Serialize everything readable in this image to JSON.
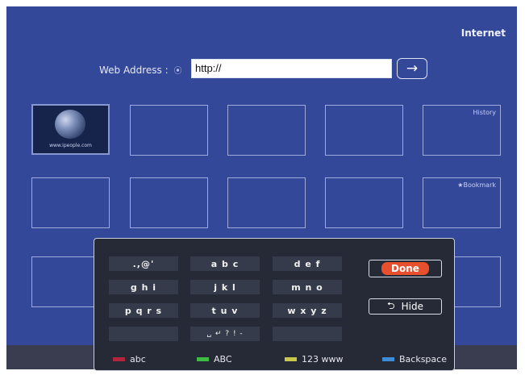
{
  "app_title": "Internet",
  "address_bar": {
    "label": "Web Address :",
    "label_icon": "circle-info-icon",
    "value": "http://",
    "go_icon": "arrow-right-icon",
    "go_glyph": "→"
  },
  "tiles": {
    "thumbnail_url": "www.ipeople.com",
    "history_label": "History",
    "bookmark_label": "★Bookmark"
  },
  "keyboard": {
    "row1": [
      ".,@'",
      "a b c",
      "d e f"
    ],
    "row2": [
      "g h i",
      "j k l",
      "m n o"
    ],
    "row3": [
      "p q r s",
      "t u v",
      "w x y z"
    ],
    "row4": [
      "",
      "␣ ↵ ? ! -",
      ""
    ],
    "done_label": "Done",
    "hide_label": "Hide",
    "hide_glyph": "⮌",
    "color_keys": [
      {
        "label": "abc",
        "color": "#b2253a"
      },
      {
        "label": "ABC",
        "color": "#3dbb45"
      },
      {
        "label": "123 www",
        "color": "#c9c84a"
      },
      {
        "label": "Backspace",
        "color": "#3d8ed6"
      }
    ]
  },
  "colors": {
    "background": "#34489a",
    "done_accent": "#e84f2c",
    "panel": "#262a36"
  }
}
